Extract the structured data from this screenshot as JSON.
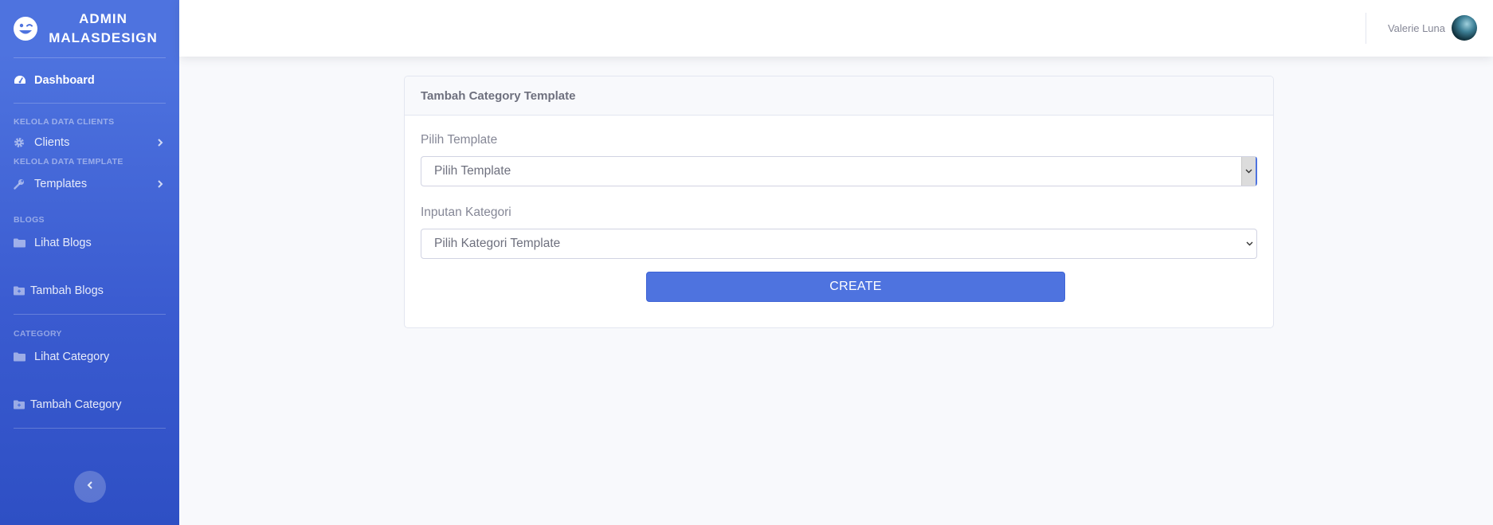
{
  "brand": {
    "line1": "ADMIN",
    "line2": "MALASDESIGN",
    "icon": "laugh-wink-icon"
  },
  "sidebar": {
    "dashboard": {
      "label": "Dashboard",
      "icon": "tachometer-icon"
    },
    "heading_clients": "KELOLA DATA CLIENTS",
    "clients": {
      "label": "Clients",
      "icon": "cog-icon"
    },
    "heading_template": "KELOLA DATA TEMPLATE",
    "templates": {
      "label": "Templates",
      "icon": "wrench-icon"
    },
    "heading_blogs": "BLOGS",
    "lihat_blogs": {
      "label": "Lihat Blogs",
      "icon": "folder-icon"
    },
    "tambah_blogs": {
      "label": "Tambah Blogs",
      "icon": "folder-plus-icon"
    },
    "heading_category": "CATEGORY",
    "lihat_category": {
      "label": "Lihat Category",
      "icon": "folder-icon"
    },
    "tambah_category": {
      "label": "Tambah Category",
      "icon": "folder-plus-icon"
    }
  },
  "topbar": {
    "user_name": "Valerie Luna"
  },
  "card": {
    "title": "Tambah Category Template",
    "field1": {
      "label": "Pilih Template",
      "value": "Pilih Template"
    },
    "field2": {
      "label": "Inputan Kategori",
      "value": "Pilih Kategori Template"
    },
    "submit_label": "CREATE"
  },
  "colors": {
    "primary": "#4e73df",
    "sidebar_dark": "#2e4fc4",
    "text_muted": "#858796"
  }
}
